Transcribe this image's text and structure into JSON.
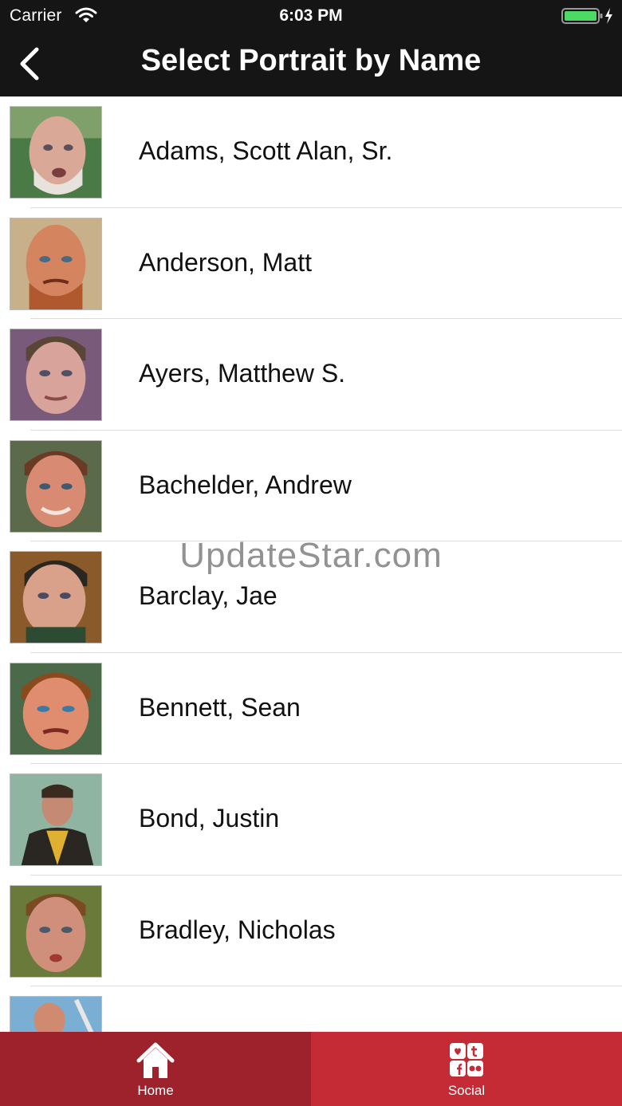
{
  "status_bar": {
    "carrier": "Carrier",
    "time": "6:03 PM",
    "wifi_icon": "wifi-icon",
    "battery_icon": "battery-charging-icon",
    "battery_color": "#4cd964"
  },
  "nav": {
    "title": "Select Portrait by Name",
    "back_icon": "chevron-left-icon"
  },
  "portraits": [
    {
      "name": "Adams, Scott Alan, Sr."
    },
    {
      "name": "Anderson, Matt"
    },
    {
      "name": "Ayers, Matthew S."
    },
    {
      "name": "Bachelder, Andrew"
    },
    {
      "name": "Barclay, Jae"
    },
    {
      "name": "Bennett, Sean"
    },
    {
      "name": "Bond, Justin"
    },
    {
      "name": "Bradley, Nicholas"
    }
  ],
  "watermark": "UpdateStar.com",
  "tab_bar": {
    "home_label": "Home",
    "social_label": "Social",
    "home_icon": "home-icon",
    "social_icon": "social-media-icon",
    "home_color": "#9e222b",
    "social_color": "#c42b35"
  }
}
